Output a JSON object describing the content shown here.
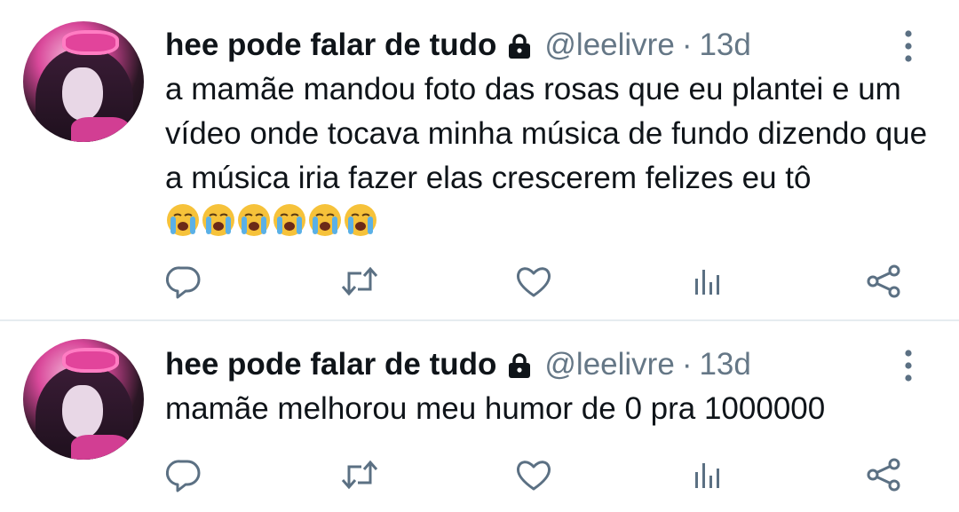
{
  "tweets": [
    {
      "name": "hee pode falar de tudo",
      "handle": "@leelivre",
      "separator": "·",
      "time": "13d",
      "text": "a mamãe mandou foto das rosas que eu plantei e um vídeo onde tocava minha música de fundo dizendo que a música iria fazer elas crescerem felizes eu tô ",
      "emoji": [
        "loudly-crying-face",
        "loudly-crying-face",
        "loudly-crying-face",
        "loudly-crying-face",
        "loudly-crying-face",
        "loudly-crying-face"
      ]
    },
    {
      "name": "hee pode falar de tudo",
      "handle": "@leelivre",
      "separator": "·",
      "time": "13d",
      "text": "mamãe melhorou meu humor de 0 pra 1000000",
      "emoji": []
    }
  ],
  "icons": {
    "reply": "reply-icon",
    "retweet": "retweet-icon",
    "like": "heart-icon",
    "stats": "analytics-icon",
    "share": "share-icon",
    "more": "more-options-icon",
    "lock": "lock-icon"
  },
  "colors": {
    "text": "#0f1419",
    "secondary": "#657786",
    "divider": "#e6ecf0",
    "icon": "#5b7083"
  }
}
